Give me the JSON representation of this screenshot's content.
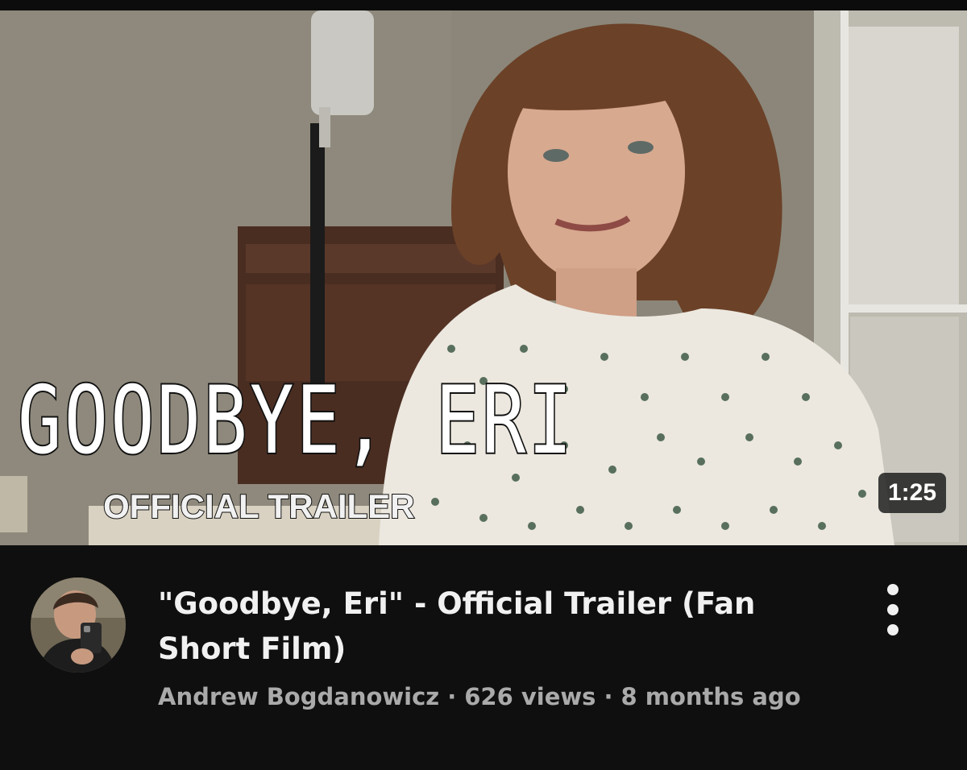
{
  "video": {
    "thumbnail_title": "GOODBYE, ERI",
    "thumbnail_subtitle": "OFFICIAL TRAILER",
    "duration": "1:25",
    "title": "\"Goodbye, Eri\" - Official Trailer (Fan Short Film)",
    "channel": "Andrew Bogdanowicz",
    "views": "626 views",
    "age": "8 months ago",
    "separator": "·"
  },
  "icons": {
    "more": "vertical-ellipsis-icon"
  },
  "colors": {
    "background": "#0f0f0f",
    "title_text": "#f1f1f1",
    "meta_text": "#aaaaaa"
  }
}
